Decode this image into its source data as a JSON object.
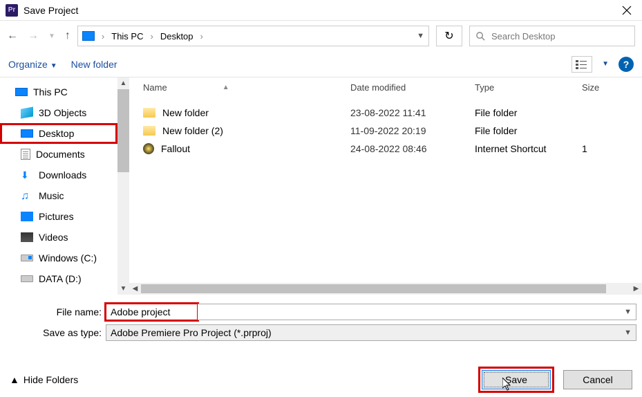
{
  "window": {
    "title": "Save Project"
  },
  "breadcrumb": {
    "item1": "This PC",
    "item2": "Desktop"
  },
  "search": {
    "placeholder": "Search Desktop"
  },
  "toolbar": {
    "organize": "Organize",
    "newfolder": "New folder"
  },
  "tree": {
    "thispc": "This PC",
    "objects3d": "3D Objects",
    "desktop": "Desktop",
    "documents": "Documents",
    "downloads": "Downloads",
    "music": "Music",
    "pictures": "Pictures",
    "videos": "Videos",
    "windowsc": "Windows (C:)",
    "datad": "DATA (D:)"
  },
  "columns": {
    "name": "Name",
    "date": "Date modified",
    "type": "Type",
    "size": "Size"
  },
  "files": [
    {
      "name": "New folder",
      "date": "23-08-2022 11:41",
      "type": "File folder",
      "icon": "folder"
    },
    {
      "name": "New folder (2)",
      "date": "11-09-2022 20:19",
      "type": "File folder",
      "icon": "folder"
    },
    {
      "name": "Fallout",
      "date": "24-08-2022 08:46",
      "type": "Internet Shortcut",
      "icon": "shortcut",
      "size": "1"
    }
  ],
  "form": {
    "filename_label": "File name:",
    "filename_value": "Adobe project",
    "saveastype_label": "Save as type:",
    "saveastype_value": "Adobe Premiere Pro Project (*.prproj)"
  },
  "buttons": {
    "hidefolders": "Hide Folders",
    "save": "Save",
    "cancel": "Cancel"
  }
}
